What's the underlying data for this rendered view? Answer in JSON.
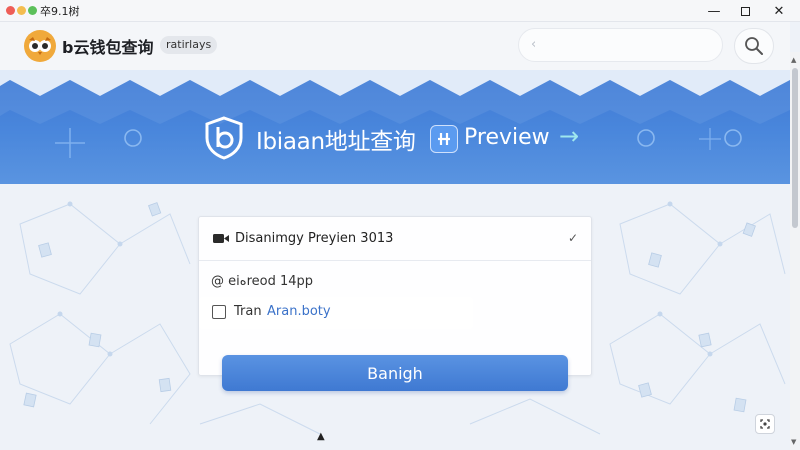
{
  "window": {
    "title": "卒9.1树"
  },
  "header": {
    "app_name": "b云钱包查询",
    "app_pill": "ratirlays",
    "address_value": ""
  },
  "banner": {
    "title": "Ibiaan地址查询",
    "preview": "Preview",
    "arrow": "→"
  },
  "card": {
    "title": "Disanimgy Preyien 3013",
    "field_text": "@ eiهreod 14pp",
    "checkbox_label": "Tran",
    "checkbox_link": "Aran.boty"
  },
  "primary_button": {
    "label": "Banigh"
  },
  "colors": {
    "accent": "#4a87dc",
    "banner_arrow": "#9ee7ee",
    "link": "#3b72c9",
    "logo": "#f0a93b"
  },
  "icons": {
    "logo": "owl-icon",
    "search": "search-icon",
    "banner": "shield-b-icon",
    "badge": "hash-icon",
    "card": "video-icon",
    "card_chevron": "chevron-down-icon",
    "corner": "screenshot-icon"
  }
}
